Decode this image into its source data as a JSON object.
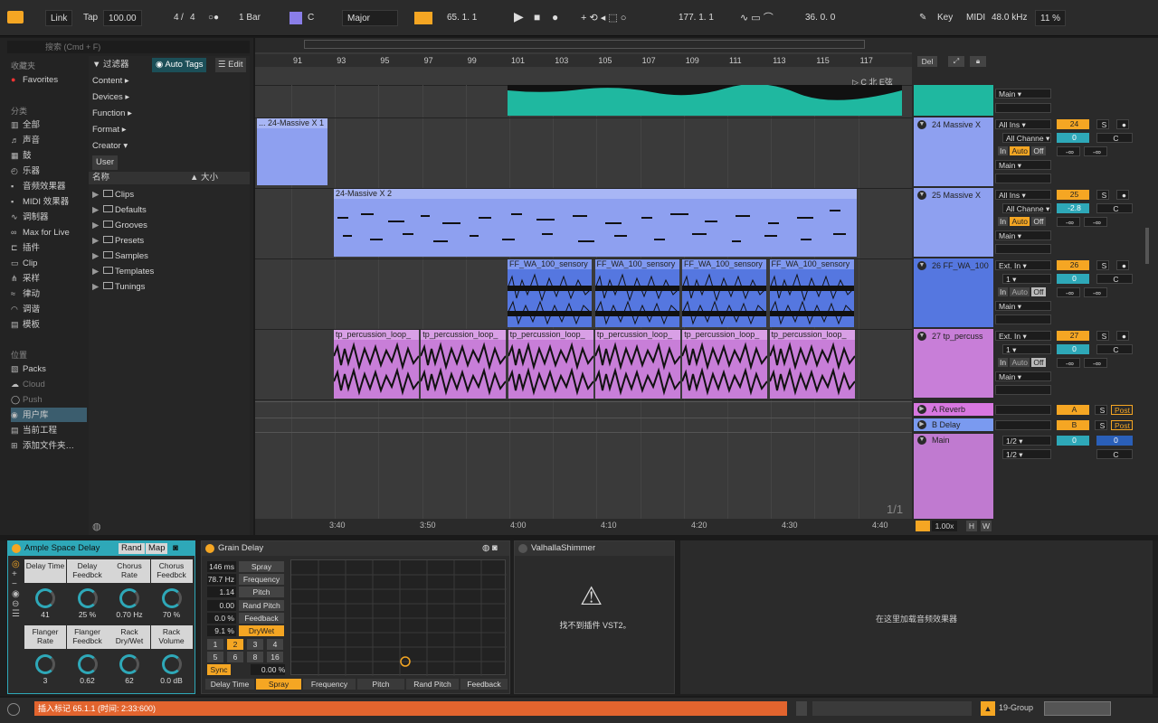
{
  "transport": {
    "link": "Link",
    "tap": "Tap",
    "tempo": "100.00",
    "sig_num": "4",
    "sig_slash": "/",
    "sig_den": "4",
    "metro": "○●",
    "quantize": "1 Bar",
    "key_root": "C",
    "scale": "Major",
    "position": "65.  1.  1",
    "loop_start": "177.  1.  1",
    "loop_len": "36.  0.  0",
    "key_btn": "Key",
    "midi_btn": "MIDI",
    "sample_rate": "48.0 kHz",
    "cpu": "11 %"
  },
  "browser": {
    "search_placeholder": "搜索 (Cmd + F)",
    "collections_header": "收藏夹",
    "favorites": "Favorites",
    "categories_header": "分类",
    "categories": [
      "全部",
      "声音",
      "鼓",
      "乐器",
      "音频效果器",
      "MIDI 效果器",
      "调制器",
      "Max for Live",
      "插件",
      "Clip",
      "采样",
      "律动",
      "调谐",
      "模板"
    ],
    "places_header": "位置",
    "places": [
      "Packs",
      "Cloud",
      "Push",
      "用户库",
      "当前工程",
      "添加文件夹…"
    ],
    "filter_label": "过滤器",
    "auto_tags": "Auto Tags",
    "edit": "Edit",
    "filter_items": [
      "Content ▸",
      "Devices ▸",
      "Function ▸",
      "Format ▸",
      "Creator ▾",
      "User"
    ],
    "col_name": "名称",
    "col_size": "大小",
    "folders": [
      "Clips",
      "Defaults",
      "Grooves",
      "Presets",
      "Samples",
      "Templates",
      "Tunings"
    ]
  },
  "arrangement": {
    "bars": [
      "91",
      "93",
      "95",
      "97",
      "99",
      "101",
      "103",
      "105",
      "107",
      "109",
      "111",
      "113",
      "115",
      "117"
    ],
    "locator": "▷ C 北 E弦",
    "times": [
      "3:40",
      "3:50",
      "4:00",
      "4:10",
      "4:20",
      "4:30",
      "4:40"
    ],
    "page": "1/1",
    "zoom": "1.00x",
    "h": "H",
    "w": "W",
    "del": "Del",
    "clips": {
      "massive1": "... 24-Massive X 1",
      "massive2": "24-Massive X 2",
      "ff": [
        "FF_WA_100_sensory",
        "FF_WA_100_sensory",
        "FF_WA_100_sensory",
        "FF_WA_100_sensory"
      ],
      "perc": [
        "tp_percussion_loop_",
        "tp_percussion_loop_",
        "tp_percussion_loop_",
        "tp_percussion_loop_",
        "tp_percussion_loop_",
        "tp_percussion_loop_"
      ]
    }
  },
  "tracks": [
    {
      "name": "24 Massive X",
      "input": "All Ins",
      "channel": "All Channe",
      "num": "24",
      "vol": "0",
      "pan": "C",
      "out": "Main"
    },
    {
      "name": "25 Massive X",
      "input": "All Ins",
      "channel": "All Channe",
      "num": "25",
      "vol": "-2.8",
      "pan": "C",
      "out": "Main"
    },
    {
      "name": "26 FF_WA_100",
      "input": "Ext. In",
      "channel": "1",
      "num": "26",
      "vol": "0",
      "pan": "C",
      "out": "Main"
    },
    {
      "name": "27 tp_percuss",
      "input": "Ext. In",
      "channel": "1",
      "num": "27",
      "vol": "0",
      "pan": "C",
      "out": "Main"
    }
  ],
  "mixer_labels": {
    "in": "In",
    "auto": "Auto",
    "off": "Off",
    "s": "S",
    "inf": "-∞",
    "post": "Post",
    "top_out": "Main"
  },
  "returns": [
    {
      "name": "A Reverb",
      "letter": "A"
    },
    {
      "name": "B Delay",
      "letter": "B"
    }
  ],
  "master": {
    "name": "Main",
    "cue1": "1/2",
    "cue2": "1/2",
    "vol": "0",
    "vol2": "0",
    "pan": "C"
  },
  "devices": {
    "ample": {
      "title": "Ample Space Delay",
      "rand": "Rand",
      "map": "Map",
      "knobs": [
        {
          "label": "Delay Time",
          "value": "41"
        },
        {
          "label": "Delay Feedbck",
          "value": "25 %"
        },
        {
          "label": "Chorus Rate",
          "value": "0.70 Hz"
        },
        {
          "label": "Chorus Feedbck",
          "value": "70 %"
        },
        {
          "label": "Flanger Rate",
          "value": "3"
        },
        {
          "label": "Flanger Feedbck",
          "value": "0.62"
        },
        {
          "label": "Rack Dry/Wet",
          "value": "62"
        },
        {
          "label": "Rack Volume",
          "value": "0.0 dB"
        }
      ]
    },
    "grain": {
      "title": "Grain Delay",
      "rows": [
        {
          "value": "146 ms",
          "label": "Spray"
        },
        {
          "value": "78.7 Hz",
          "label": "Frequency"
        },
        {
          "value": "1.14",
          "label": "Pitch"
        },
        {
          "value": "0.00",
          "label": "Rand Pitch"
        },
        {
          "value": "0.0 %",
          "label": "Feedback"
        },
        {
          "value": "9.1 %",
          "label": "DryWet"
        }
      ],
      "beats": [
        "1",
        "2",
        "3",
        "4",
        "5",
        "6",
        "8",
        "16"
      ],
      "sync": "Sync",
      "sync_val": "0.00 %",
      "tabs": [
        "Delay Time",
        "Spray",
        "Frequency",
        "Pitch",
        "Rand Pitch",
        "Feedback"
      ]
    },
    "valhalla": {
      "title": "ValhallaShimmer",
      "msg": "找不到插件 VST2。"
    },
    "drop_hint": "在这里加载音频效果器"
  },
  "status": {
    "message": "插入标记 65.1.1 (时间:  2:33:600)",
    "group": "19-Group"
  },
  "colors": {
    "accent": "#f5a623",
    "teal": "#1fb8a0",
    "blue": "#8ea0f0",
    "sample_blue": "#5577e0",
    "perc": "#c87ed8"
  }
}
